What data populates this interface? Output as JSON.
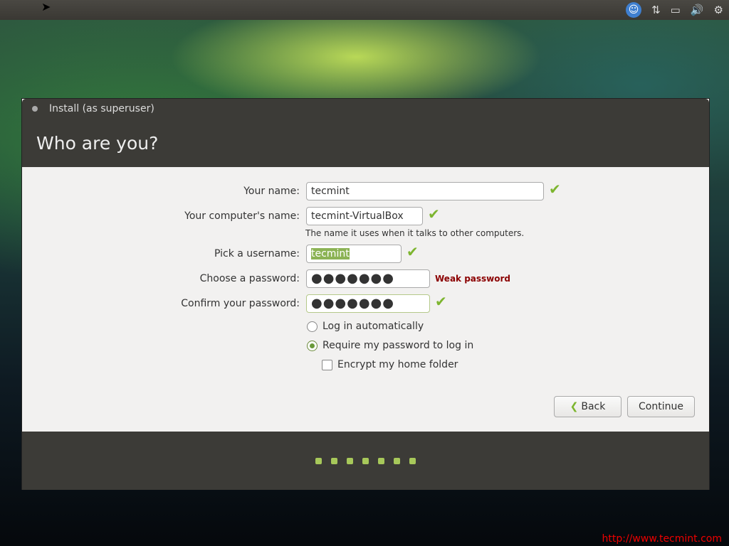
{
  "window": {
    "title": "Install (as superuser)",
    "heading": "Who are you?"
  },
  "form": {
    "name_label": "Your name:",
    "name_value": "tecmint",
    "computer_label": "Your computer's name:",
    "computer_value": "tecmint-VirtualBox",
    "computer_hint": "The name it uses when it talks to other computers.",
    "username_label": "Pick a username:",
    "username_value": "tecmint",
    "password_label": "Choose a password:",
    "password_value": "●●●●●●●",
    "password_strength": "Weak password",
    "confirm_label": "Confirm your password:",
    "confirm_value": "●●●●●●●",
    "login_auto": "Log in automatically",
    "login_require": "Require my password to log in",
    "encrypt": "Encrypt my home folder"
  },
  "buttons": {
    "back": "Back",
    "continue": "Continue"
  },
  "progress": {
    "steps": 7
  },
  "watermark": "http://www.tecmint.com",
  "colors": {
    "accent": "#7db52f",
    "warning": "#8b0000"
  }
}
